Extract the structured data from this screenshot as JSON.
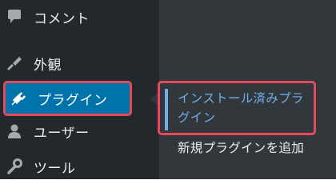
{
  "sidebar": {
    "items": [
      {
        "id": "comments",
        "label": "コメント",
        "icon": "comment-icon"
      },
      {
        "id": "appearance",
        "label": "外観",
        "icon": "paintbrush-icon"
      },
      {
        "id": "plugins",
        "label": "プラグイン",
        "icon": "plugin-icon",
        "active": true
      },
      {
        "id": "users",
        "label": "ユーザー",
        "icon": "user-icon"
      },
      {
        "id": "tools",
        "label": "ツール",
        "icon": "wrench-icon"
      }
    ]
  },
  "submenu": {
    "items": [
      {
        "label": "インストール済みプラグイン",
        "current": true
      },
      {
        "label": "新規プラグインを追加"
      }
    ]
  },
  "colors": {
    "sidebar_bg": "#23282d",
    "submenu_bg": "#32373c",
    "active_bg": "#0073aa",
    "highlight_border": "#e64a5a",
    "current_text": "#72aee6",
    "text": "#eeeeee"
  }
}
